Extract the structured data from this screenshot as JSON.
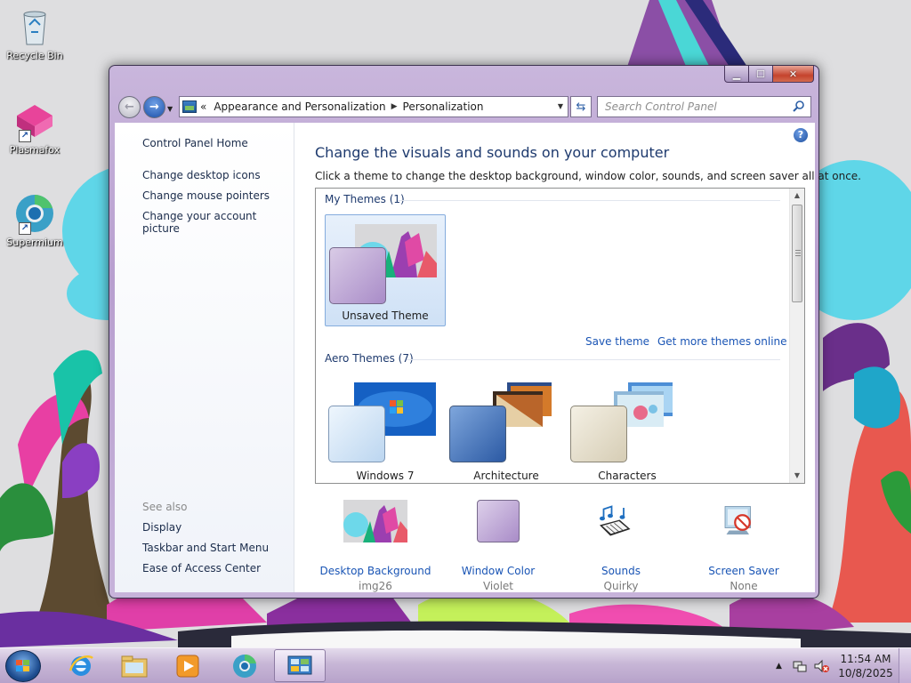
{
  "desktop": {
    "icons": [
      {
        "label": "Recycle Bin",
        "icon": "recycle-bin-icon"
      },
      {
        "label": "Plasmafox",
        "icon": "plasmafox-icon"
      },
      {
        "label": "Supermium",
        "icon": "supermium-icon"
      }
    ]
  },
  "window": {
    "caption_buttons": {
      "minimize": "minimize-icon",
      "maximize": "maximize-icon",
      "close": "close-icon"
    },
    "address": {
      "crumbs": [
        "Appearance and Personalization",
        "Personalization"
      ],
      "overflow_glyph": "«"
    },
    "search": {
      "placeholder": "Search Control Panel"
    },
    "left_pane": {
      "home": "Control Panel Home",
      "links": [
        "Change desktop icons",
        "Change mouse pointers",
        "Change your account picture"
      ],
      "see_also_label": "See also",
      "see_also": [
        "Display",
        "Taskbar and Start Menu",
        "Ease of Access Center"
      ]
    },
    "main": {
      "heading": "Change the visuals and sounds on your computer",
      "description": "Click a theme to change the desktop background, window color, sounds, and screen saver all at once.",
      "my_themes_title": "My Themes (1)",
      "my_themes": [
        {
          "label": "Unsaved Theme",
          "selected": true,
          "swatch": "#b9a2d3"
        }
      ],
      "save_theme": "Save theme",
      "get_more": "Get more themes online",
      "aero_themes_title": "Aero Themes (7)",
      "aero_themes": [
        {
          "label": "Windows 7",
          "swatch": "#cfe3f6"
        },
        {
          "label": "Architecture",
          "swatch": "#3a6fb4"
        },
        {
          "label": "Characters",
          "swatch": "#e9e3d2"
        }
      ],
      "settings": [
        {
          "label": "Desktop Background",
          "value": "img26",
          "icon": "desktop-background-icon"
        },
        {
          "label": "Window Color",
          "value": "Violet",
          "icon": "window-color-icon"
        },
        {
          "label": "Sounds",
          "value": "Quirky",
          "icon": "sounds-icon"
        },
        {
          "label": "Screen Saver",
          "value": "None",
          "icon": "screen-saver-icon"
        }
      ]
    }
  },
  "taskbar": {
    "pinned": [
      "internet-explorer-icon",
      "explorer-icon",
      "media-player-icon",
      "supermium-icon",
      "control-panel-icon"
    ],
    "clock": {
      "time": "11:54 AM",
      "date": "10/8/2025"
    }
  },
  "colors": {
    "accent_link": "#1a55b5",
    "heading": "#1e3a6e",
    "window_frame": "#b89fcf"
  }
}
